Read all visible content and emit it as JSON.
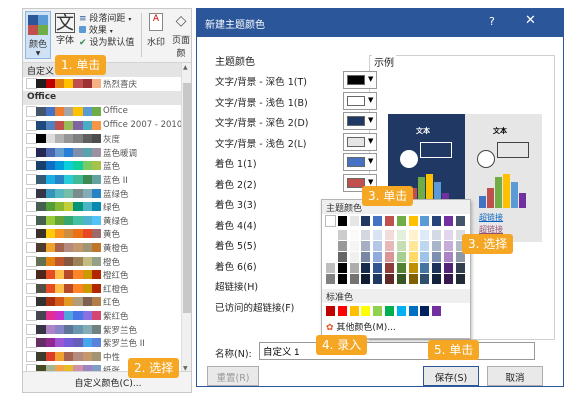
{
  "ribbon": {
    "colors_label": "颜色",
    "fonts_label": "字体",
    "paragraph_spacing": "段落间距",
    "effects": "效果",
    "set_default": "设为默认值",
    "watermark": "水印",
    "page_color": "页面颜"
  },
  "list": {
    "custom_header": "自定义",
    "custom_item": "热烈喜庆",
    "office_header": "Office",
    "items": [
      {
        "label": "Office",
        "colors": [
          "#ffffff",
          "#44546a",
          "#4472c4",
          "#ed7d31",
          "#a5a5a5",
          "#ffc000",
          "#5b9bd5",
          "#70ad47"
        ]
      },
      {
        "label": "Office 2007 - 2010",
        "colors": [
          "#ffffff",
          "#1f497d",
          "#4f81bd",
          "#c0504d",
          "#9bbb59",
          "#8064a2",
          "#4bacc6",
          "#f79646"
        ]
      },
      {
        "label": "灰度",
        "colors": [
          "#ffffff",
          "#000000",
          "#dddddd",
          "#b2b2b2",
          "#969696",
          "#808080",
          "#5f5f5f",
          "#4d4d4d"
        ]
      },
      {
        "label": "蓝色暖调",
        "colors": [
          "#ffffff",
          "#242852",
          "#4a66ac",
          "#629dd1",
          "#297fd5",
          "#7f8fa9",
          "#5aa2ae",
          "#9d90a0"
        ]
      },
      {
        "label": "蓝色",
        "colors": [
          "#ffffff",
          "#17406d",
          "#0f6fc6",
          "#009dd9",
          "#0bd0d9",
          "#10cf9b",
          "#7cca62",
          "#a5c249"
        ]
      },
      {
        "label": "蓝色 II",
        "colors": [
          "#ffffff",
          "#335b74",
          "#1cade4",
          "#2683c6",
          "#27ced7",
          "#42ba97",
          "#3e8853",
          "#62a39f"
        ]
      },
      {
        "label": "蓝绿色",
        "colors": [
          "#ffffff",
          "#373545",
          "#3494ba",
          "#58b6c0",
          "#75bda7",
          "#7a8c8e",
          "#84acb6",
          "#2683c6"
        ]
      },
      {
        "label": "绿色",
        "colors": [
          "#ffffff",
          "#455f51",
          "#549e39",
          "#8ab833",
          "#c0cf3a",
          "#029676",
          "#4ab5c4",
          "#0989b1"
        ]
      },
      {
        "label": "黄绿色",
        "colors": [
          "#ffffff",
          "#455f51",
          "#99cb38",
          "#63a537",
          "#37a76f",
          "#44c1a3",
          "#4eb3cf",
          "#51c3f9"
        ]
      },
      {
        "label": "黄色",
        "colors": [
          "#ffffff",
          "#39302a",
          "#ffca08",
          "#f8931d",
          "#ce8d3e",
          "#ec7016",
          "#e64823",
          "#9c6a6a"
        ]
      },
      {
        "label": "黄橙色",
        "colors": [
          "#ffffff",
          "#4e3b30",
          "#f0a22e",
          "#a5644e",
          "#b58b80",
          "#c3986d",
          "#a19574",
          "#c17529"
        ]
      },
      {
        "label": "橙色",
        "colors": [
          "#ffffff",
          "#637052",
          "#e48312",
          "#bd582c",
          "#865640",
          "#9b8357",
          "#c2bc80",
          "#94a088"
        ]
      },
      {
        "label": "橙红色",
        "colors": [
          "#ffffff",
          "#4f271c",
          "#e84c22",
          "#ffbd47",
          "#b64926",
          "#ff8427",
          "#cc9900",
          "#b22600"
        ]
      },
      {
        "label": "红橙色",
        "colors": [
          "#ffffff",
          "#505046",
          "#e84c22",
          "#ffbd47",
          "#b64926",
          "#ff8427",
          "#cc9900",
          "#b22600"
        ]
      },
      {
        "label": "红色",
        "colors": [
          "#ffffff",
          "#323232",
          "#a5300f",
          "#d55816",
          "#e19825",
          "#b19c7d",
          "#7f5f52",
          "#b27d49"
        ]
      },
      {
        "label": "紫红色",
        "colors": [
          "#ffffff",
          "#454551",
          "#e32d91",
          "#c830cc",
          "#4ea6dc",
          "#4775e7",
          "#8971e1",
          "#d54773"
        ]
      },
      {
        "label": "紫罗兰色",
        "colors": [
          "#ffffff",
          "#373545",
          "#ad84c6",
          "#8784c7",
          "#5d739a",
          "#6997af",
          "#84acb6",
          "#6f8183"
        ]
      },
      {
        "label": "紫罗兰色 II",
        "colors": [
          "#ffffff",
          "#632e62",
          "#92278f",
          "#9b57d3",
          "#755dd9",
          "#665eb8",
          "#45a5ed",
          "#5982db"
        ]
      },
      {
        "label": "中性",
        "colors": [
          "#ffffff",
          "#3e3d2d",
          "#dc3e2a",
          "#f0a22e",
          "#a5644e",
          "#b58b80",
          "#c3986d",
          "#a19574"
        ]
      },
      {
        "label": "纸张",
        "colors": [
          "#ffffff",
          "#444d26",
          "#a5b592",
          "#f3a447",
          "#e7bc29",
          "#d092a7",
          "#9c85c0",
          "#809ec2"
        ]
      }
    ],
    "custom_swatch": [
      "#ffffff",
      "#1f1f1f",
      "#c00000",
      "#e48312",
      "#ffc000",
      "#c0504d",
      "#9c3234",
      "#f4b183"
    ],
    "custom_colors_link": "自定义颜色(C)..."
  },
  "dialog": {
    "title": "新建主题颜色",
    "help": "?",
    "close": "✕",
    "theme_colors_title": "主题颜色",
    "sample_title": "示例",
    "rows": [
      {
        "label": "文字/背景 - 深色 1(T)",
        "color": "#000000"
      },
      {
        "label": "文字/背景 - 浅色 1(B)",
        "color": "#ffffff"
      },
      {
        "label": "文字/背景 - 深色 2(D)",
        "color": "#1f3864"
      },
      {
        "label": "文字/背景 - 浅色 2(L)",
        "color": "#e7e6e6"
      },
      {
        "label": "着色 1(1)",
        "color": "#4472c4"
      },
      {
        "label": "着色 2(2)",
        "color": "#c0504d"
      },
      {
        "label": "着色 3(3)",
        "color": ""
      },
      {
        "label": "着色 4(4)",
        "color": ""
      },
      {
        "label": "着色 5(5)",
        "color": ""
      },
      {
        "label": "着色 6(6)",
        "color": ""
      },
      {
        "label": "超链接(H)",
        "color": ""
      },
      {
        "label": "已访问的超链接(F)",
        "color": ""
      }
    ],
    "preview": {
      "text_label_dark": "文本",
      "text_label_light": "文本",
      "hyperlink": "超链接",
      "visited_hyperlink": "超链接",
      "dark_bg": "#1f3864",
      "light_bg": "#e7e6e6"
    },
    "dropdown": {
      "theme_colors_title": "主题颜色",
      "standard_colors_title": "标准色",
      "more_colors": "其他颜色(M)...",
      "top_row": [
        "#ffffff",
        "#000000",
        "#e7e6e6",
        "#1f3864",
        "#4472c4",
        "#c0504d",
        "#70ad47",
        "#ffc000",
        "#5b9bd5",
        "#264478",
        "#7030a0",
        "#44546a"
      ],
      "standard": [
        "#c00000",
        "#ff0000",
        "#ffc000",
        "#ffff00",
        "#92d050",
        "#00b050",
        "#00b0f0",
        "#0070c0",
        "#002060",
        "#7030a0"
      ]
    },
    "name_label": "名称(N):",
    "name_value": "自定义 1",
    "reset_button": "重置(R)",
    "save_button": "保存(S)",
    "cancel_button": "取消"
  },
  "callouts": {
    "step1": "1. 单击",
    "step2": "2. 选择",
    "step3a": "3. 单击",
    "step3b": "3. 选择",
    "step4": "4. 录入",
    "step5": "5. 单击"
  },
  "colors": {
    "callout": "#f5a623",
    "titlebar": "#2b579a",
    "accent_blue": "#4472c4"
  }
}
